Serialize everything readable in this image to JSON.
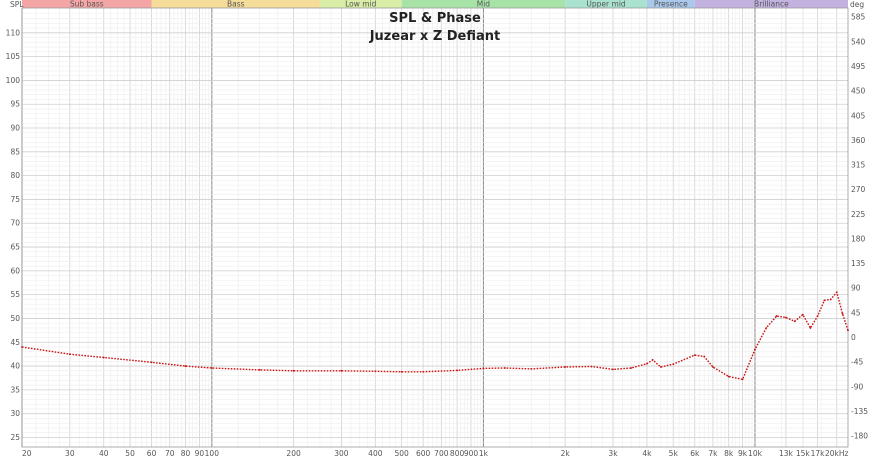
{
  "chart_data": {
    "type": "line",
    "title": "SPL & Phase",
    "subtitle": "Juzear x Z Defiant",
    "ylabel_left": "SPL",
    "ylabel_right": "deg",
    "x_scale": "log",
    "xlim": [
      20,
      22000
    ],
    "ylim_left": [
      23,
      115
    ],
    "ylim_right": [
      -200,
      600
    ],
    "grid": true,
    "x_ticks": [
      {
        "value": 20,
        "label": "20"
      },
      {
        "value": 30,
        "label": "30"
      },
      {
        "value": 40,
        "label": "40"
      },
      {
        "value": 50,
        "label": "50"
      },
      {
        "value": 60,
        "label": "60"
      },
      {
        "value": 70,
        "label": "70"
      },
      {
        "value": 80,
        "label": "80"
      },
      {
        "value": 90,
        "label": "90"
      },
      {
        "value": 100,
        "label": "100"
      },
      {
        "value": 200,
        "label": "200"
      },
      {
        "value": 300,
        "label": "300"
      },
      {
        "value": 400,
        "label": "400"
      },
      {
        "value": 500,
        "label": "500"
      },
      {
        "value": 600,
        "label": "600"
      },
      {
        "value": 700,
        "label": "700"
      },
      {
        "value": 800,
        "label": "800"
      },
      {
        "value": 900,
        "label": "900"
      },
      {
        "value": 1000,
        "label": "1k"
      },
      {
        "value": 2000,
        "label": "2k"
      },
      {
        "value": 3000,
        "label": "3k"
      },
      {
        "value": 4000,
        "label": "4k"
      },
      {
        "value": 5000,
        "label": "5k"
      },
      {
        "value": 6000,
        "label": "6k"
      },
      {
        "value": 7000,
        "label": "7k"
      },
      {
        "value": 8000,
        "label": "8k"
      },
      {
        "value": 9000,
        "label": "9k"
      },
      {
        "value": 10000,
        "label": "10k"
      },
      {
        "value": 13000,
        "label": "13k"
      },
      {
        "value": 15000,
        "label": "15k"
      },
      {
        "value": 17000,
        "label": "17k"
      },
      {
        "value": 20000,
        "label": "20kHz"
      }
    ],
    "y_ticks_left": [
      25,
      30,
      35,
      40,
      45,
      50,
      55,
      60,
      65,
      70,
      75,
      80,
      85,
      90,
      95,
      100,
      105,
      110
    ],
    "y_ticks_right": [
      -180,
      -135,
      -90,
      -45,
      0,
      45,
      90,
      135,
      180,
      225,
      270,
      315,
      360,
      405,
      450,
      495,
      540,
      585
    ],
    "bands": [
      {
        "label": "Sub bass",
        "from": 20,
        "to": 60,
        "color": "#f4a6a6"
      },
      {
        "label": "Bass",
        "from": 60,
        "to": 250,
        "color": "#f5dc99"
      },
      {
        "label": "Low mid",
        "from": 250,
        "to": 500,
        "color": "#d8eda6"
      },
      {
        "label": "Mid",
        "from": 500,
        "to": 2000,
        "color": "#a7e3a7"
      },
      {
        "label": "Upper mid",
        "from": 2000,
        "to": 4000,
        "color": "#a9e3cf"
      },
      {
        "label": "Presence",
        "from": 4000,
        "to": 6000,
        "color": "#a9c8ec"
      },
      {
        "label": "Brilliance",
        "from": 6000,
        "to": 22000,
        "color": "#c3b1df"
      }
    ],
    "series": [
      {
        "color": "#cc1111",
        "x": [
          20,
          30,
          40,
          60,
          80,
          100,
          150,
          200,
          300,
          400,
          500,
          600,
          800,
          1000,
          1200,
          1500,
          2000,
          2500,
          3000,
          3500,
          4000,
          4200,
          4500,
          5000,
          6000,
          6500,
          7000,
          8000,
          9000,
          10000,
          11000,
          12000,
          13000,
          14000,
          15000,
          16000,
          17000,
          18000,
          19000,
          20000,
          21000,
          22000
        ],
        "y": [
          44.0,
          42.5,
          41.8,
          40.8,
          40.0,
          39.6,
          39.2,
          39.0,
          39.0,
          38.9,
          38.8,
          38.8,
          39.1,
          39.5,
          39.6,
          39.4,
          39.8,
          39.9,
          39.3,
          39.6,
          40.5,
          41.3,
          39.8,
          40.4,
          42.3,
          42.0,
          39.8,
          37.8,
          37.2,
          43.5,
          48.0,
          50.5,
          50.2,
          49.4,
          50.8,
          48.0,
          50.5,
          53.8,
          54.0,
          55.5,
          51.0,
          47.5
        ]
      }
    ]
  }
}
